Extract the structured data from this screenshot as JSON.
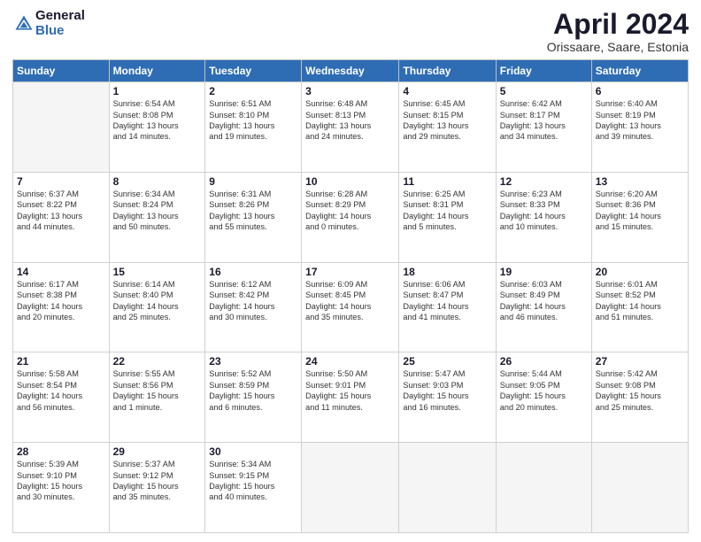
{
  "logo": {
    "general": "General",
    "blue": "Blue"
  },
  "header": {
    "title": "April 2024",
    "subtitle": "Orissaare, Saare, Estonia"
  },
  "weekdays": [
    "Sunday",
    "Monday",
    "Tuesday",
    "Wednesday",
    "Thursday",
    "Friday",
    "Saturday"
  ],
  "weeks": [
    [
      {
        "day": "",
        "info": ""
      },
      {
        "day": "1",
        "info": "Sunrise: 6:54 AM\nSunset: 8:08 PM\nDaylight: 13 hours\nand 14 minutes."
      },
      {
        "day": "2",
        "info": "Sunrise: 6:51 AM\nSunset: 8:10 PM\nDaylight: 13 hours\nand 19 minutes."
      },
      {
        "day": "3",
        "info": "Sunrise: 6:48 AM\nSunset: 8:13 PM\nDaylight: 13 hours\nand 24 minutes."
      },
      {
        "day": "4",
        "info": "Sunrise: 6:45 AM\nSunset: 8:15 PM\nDaylight: 13 hours\nand 29 minutes."
      },
      {
        "day": "5",
        "info": "Sunrise: 6:42 AM\nSunset: 8:17 PM\nDaylight: 13 hours\nand 34 minutes."
      },
      {
        "day": "6",
        "info": "Sunrise: 6:40 AM\nSunset: 8:19 PM\nDaylight: 13 hours\nand 39 minutes."
      }
    ],
    [
      {
        "day": "7",
        "info": "Sunrise: 6:37 AM\nSunset: 8:22 PM\nDaylight: 13 hours\nand 44 minutes."
      },
      {
        "day": "8",
        "info": "Sunrise: 6:34 AM\nSunset: 8:24 PM\nDaylight: 13 hours\nand 50 minutes."
      },
      {
        "day": "9",
        "info": "Sunrise: 6:31 AM\nSunset: 8:26 PM\nDaylight: 13 hours\nand 55 minutes."
      },
      {
        "day": "10",
        "info": "Sunrise: 6:28 AM\nSunset: 8:29 PM\nDaylight: 14 hours\nand 0 minutes."
      },
      {
        "day": "11",
        "info": "Sunrise: 6:25 AM\nSunset: 8:31 PM\nDaylight: 14 hours\nand 5 minutes."
      },
      {
        "day": "12",
        "info": "Sunrise: 6:23 AM\nSunset: 8:33 PM\nDaylight: 14 hours\nand 10 minutes."
      },
      {
        "day": "13",
        "info": "Sunrise: 6:20 AM\nSunset: 8:36 PM\nDaylight: 14 hours\nand 15 minutes."
      }
    ],
    [
      {
        "day": "14",
        "info": "Sunrise: 6:17 AM\nSunset: 8:38 PM\nDaylight: 14 hours\nand 20 minutes."
      },
      {
        "day": "15",
        "info": "Sunrise: 6:14 AM\nSunset: 8:40 PM\nDaylight: 14 hours\nand 25 minutes."
      },
      {
        "day": "16",
        "info": "Sunrise: 6:12 AM\nSunset: 8:42 PM\nDaylight: 14 hours\nand 30 minutes."
      },
      {
        "day": "17",
        "info": "Sunrise: 6:09 AM\nSunset: 8:45 PM\nDaylight: 14 hours\nand 35 minutes."
      },
      {
        "day": "18",
        "info": "Sunrise: 6:06 AM\nSunset: 8:47 PM\nDaylight: 14 hours\nand 41 minutes."
      },
      {
        "day": "19",
        "info": "Sunrise: 6:03 AM\nSunset: 8:49 PM\nDaylight: 14 hours\nand 46 minutes."
      },
      {
        "day": "20",
        "info": "Sunrise: 6:01 AM\nSunset: 8:52 PM\nDaylight: 14 hours\nand 51 minutes."
      }
    ],
    [
      {
        "day": "21",
        "info": "Sunrise: 5:58 AM\nSunset: 8:54 PM\nDaylight: 14 hours\nand 56 minutes."
      },
      {
        "day": "22",
        "info": "Sunrise: 5:55 AM\nSunset: 8:56 PM\nDaylight: 15 hours\nand 1 minute."
      },
      {
        "day": "23",
        "info": "Sunrise: 5:52 AM\nSunset: 8:59 PM\nDaylight: 15 hours\nand 6 minutes."
      },
      {
        "day": "24",
        "info": "Sunrise: 5:50 AM\nSunset: 9:01 PM\nDaylight: 15 hours\nand 11 minutes."
      },
      {
        "day": "25",
        "info": "Sunrise: 5:47 AM\nSunset: 9:03 PM\nDaylight: 15 hours\nand 16 minutes."
      },
      {
        "day": "26",
        "info": "Sunrise: 5:44 AM\nSunset: 9:05 PM\nDaylight: 15 hours\nand 20 minutes."
      },
      {
        "day": "27",
        "info": "Sunrise: 5:42 AM\nSunset: 9:08 PM\nDaylight: 15 hours\nand 25 minutes."
      }
    ],
    [
      {
        "day": "28",
        "info": "Sunrise: 5:39 AM\nSunset: 9:10 PM\nDaylight: 15 hours\nand 30 minutes."
      },
      {
        "day": "29",
        "info": "Sunrise: 5:37 AM\nSunset: 9:12 PM\nDaylight: 15 hours\nand 35 minutes."
      },
      {
        "day": "30",
        "info": "Sunrise: 5:34 AM\nSunset: 9:15 PM\nDaylight: 15 hours\nand 40 minutes."
      },
      {
        "day": "",
        "info": ""
      },
      {
        "day": "",
        "info": ""
      },
      {
        "day": "",
        "info": ""
      },
      {
        "day": "",
        "info": ""
      }
    ]
  ]
}
